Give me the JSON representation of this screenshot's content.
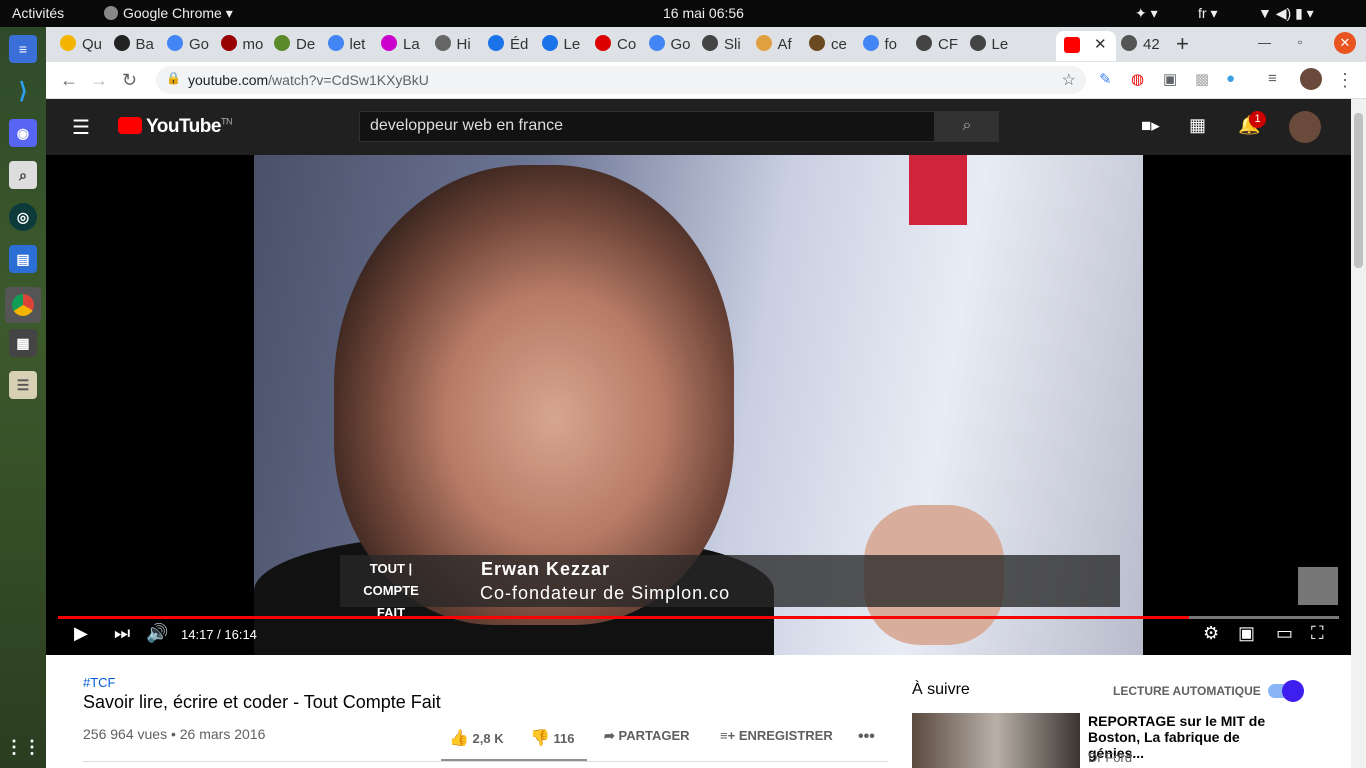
{
  "system": {
    "activities": "Activités",
    "app": "Google Chrome",
    "clock": "16 mai  06:56",
    "lang": "fr"
  },
  "tabs": [
    "Qu",
    "Ba",
    "Go",
    "mo",
    "De",
    "let",
    "La",
    "Hi",
    "Éd",
    "Le",
    "Co",
    "Go",
    "Sli",
    "Af",
    "ce",
    "fo",
    "CF",
    "Le",
    "",
    "42"
  ],
  "address": {
    "url_host": "youtube.com",
    "url_path": "/watch?v=CdSw1KXyBkU"
  },
  "youtube": {
    "brand": "YouTube",
    "region": "TN",
    "search_value": "developpeur web en france",
    "notif_count": "1"
  },
  "video": {
    "lower_third_logo_1": "TOUT | COMPTE",
    "lower_third_logo_2": "FAIT",
    "person_name": "Erwan Kezzar",
    "person_role": "Co-fondateur de Simplon.co",
    "time": "14:17 / 16:14",
    "progress": 0.883
  },
  "meta": {
    "hashtag": "#TCF",
    "title": "Savoir lire, écrire et coder - Tout Compte Fait",
    "views": "256 964 vues • 26 mars 2016",
    "likes": "2,8 K",
    "dislikes": "116",
    "share": "PARTAGER",
    "save": "ENREGISTRER"
  },
  "sidebar": {
    "next": "À suivre",
    "autoplay": "LECTURE AUTOMATIQUE",
    "rec_title": "REPORTAGE sur le MIT de Boston, La fabrique de génies...",
    "rec_channel": "Dr Ford"
  }
}
